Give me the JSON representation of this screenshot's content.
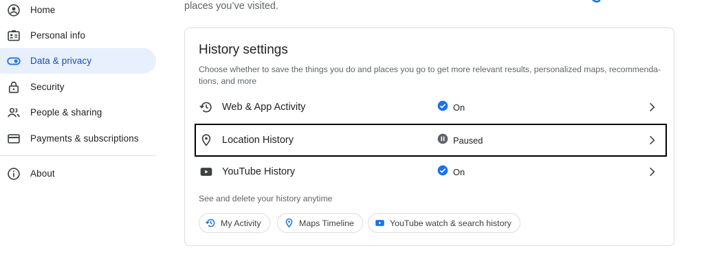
{
  "sidebar": {
    "items": [
      {
        "label": "Home",
        "icon": "home-icon"
      },
      {
        "label": "Personal info",
        "icon": "personal-info-icon"
      },
      {
        "label": "Data & privacy",
        "icon": "toggle-icon",
        "active": true
      },
      {
        "label": "Security",
        "icon": "lock-icon"
      },
      {
        "label": "People & sharing",
        "icon": "people-icon"
      },
      {
        "label": "Payments & subscriptions",
        "icon": "credit-card-icon"
      },
      {
        "label": "About",
        "icon": "info-icon"
      }
    ]
  },
  "main": {
    "top_text": "places you’ve visited.",
    "card": {
      "title": "History settings",
      "description": "Choose whether to save the things you do and places you go to get more relevant results, personalized maps, recommenda-tions, and more",
      "rows": [
        {
          "label": "Web & App Activity",
          "status": "On",
          "status_icon": "check-circle-icon",
          "icon": "history-icon"
        },
        {
          "label": "Location History",
          "status": "Paused",
          "status_icon": "pause-circle-icon",
          "icon": "location-pin-icon"
        },
        {
          "label": "YouTube History",
          "status": "On",
          "status_icon": "check-circle-icon",
          "icon": "youtube-icon"
        }
      ],
      "see_text": "See and delete your history anytime",
      "chips": [
        {
          "label": "My Activity",
          "icon": "history-icon"
        },
        {
          "label": "Maps Timeline",
          "icon": "location-pin-icon"
        },
        {
          "label": "YouTube watch & search history",
          "icon": "youtube-icon"
        }
      ]
    }
  },
  "colors": {
    "accent": "#1a73e8",
    "active_bg": "#e8f0fe",
    "active_text": "#174ea6",
    "paused_grey": "#5f6368",
    "highlight_border": "#000000"
  }
}
